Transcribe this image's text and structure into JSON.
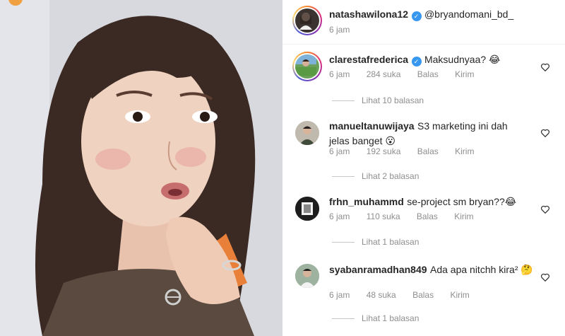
{
  "header": {
    "username": "natashawilona12",
    "mention": "@bryandomani_bd_",
    "time": "6 jam"
  },
  "comments": [
    {
      "username": "clarestafrederica",
      "verified": true,
      "text": "Maksudnyaa? 😂",
      "time": "6 jam",
      "likes": "284 suka",
      "reply": "Balas",
      "send": "Kirim",
      "view_replies": "Lihat 10 balasan"
    },
    {
      "username": "manueltanuwijaya",
      "text": "S3 marketing ini dah jelas banget 😮",
      "time": "6 jam",
      "likes": "192 suka",
      "reply": "Balas",
      "send": "Kirim",
      "view_replies": "Lihat 2 balasan"
    },
    {
      "username": "frhn_muhammd",
      "text": "se-project sm bryan??😂",
      "time": "6 jam",
      "likes": "110 suka",
      "reply": "Balas",
      "send": "Kirim",
      "view_replies": "Lihat 1 balasan"
    },
    {
      "username": "syabanramadhan849",
      "text": "Ada apa nitchh kira² 🤔",
      "time": "6 jam",
      "likes": "48 suka",
      "reply": "Balas",
      "send": "Kirim",
      "view_replies": "Lihat 1 balasan"
    }
  ],
  "icons": {
    "verified": "verified-badge-icon",
    "like": "heart-outline-icon"
  },
  "colors": {
    "verified_blue": "#3897f0",
    "meta_gray": "#8e8e8e",
    "text": "#262626"
  }
}
